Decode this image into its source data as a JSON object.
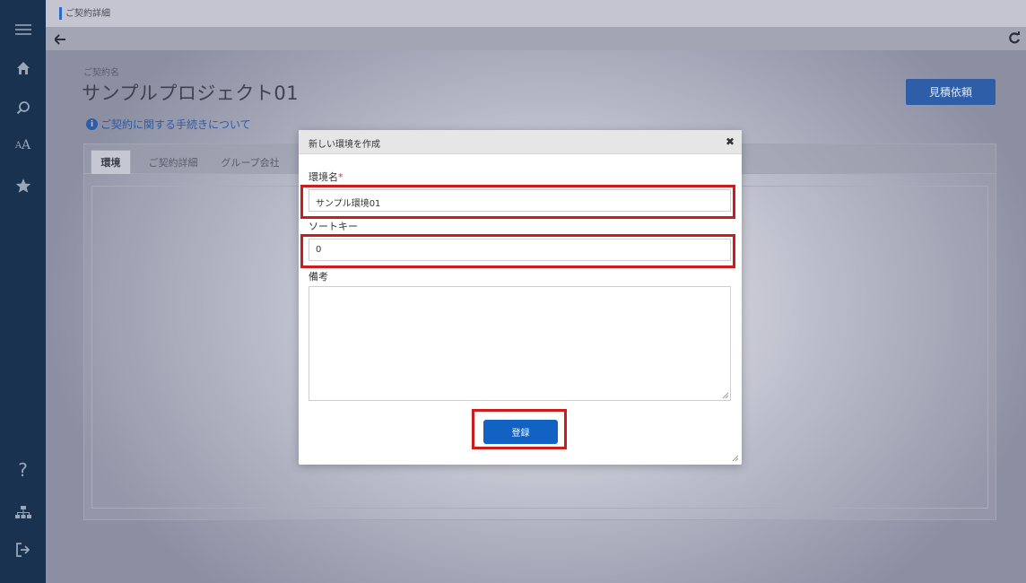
{
  "sidebar": {
    "icons": [
      {
        "name": "menu-icon"
      },
      {
        "name": "home-icon"
      },
      {
        "name": "search-icon"
      },
      {
        "name": "font-size-icon"
      },
      {
        "name": "star-icon"
      },
      {
        "name": "help-icon"
      },
      {
        "name": "sitemap-icon"
      },
      {
        "name": "logout-icon"
      }
    ]
  },
  "header": {
    "breadcrumb": "ご契約詳細"
  },
  "page": {
    "contract_label": "ご契約名",
    "title": "サンプルプロジェクト01",
    "help_icon_glyph": "i",
    "help_link": "ご契約に関する手続きについて",
    "quote_button": "見積依頼"
  },
  "tabs": [
    {
      "label": "環境",
      "active": true
    },
    {
      "label": "ご契約詳細",
      "active": false
    },
    {
      "label": "グループ会社",
      "active": false
    }
  ],
  "modal": {
    "title": "新しい環境を作成",
    "close_glyph": "✖",
    "env_name_label": "環境名",
    "required_mark": "*",
    "env_name_value": "サンプル環境01",
    "sort_key_label": "ソートキー",
    "sort_key_value": "0",
    "notes_label": "備考",
    "notes_value": "",
    "register_button": "登録"
  },
  "colors": {
    "sidebar": "#18324f",
    "accent": "#2f5ea8",
    "primary_button": "#1262c4",
    "highlight": "#cc1d1d",
    "required": "#d9342b"
  }
}
